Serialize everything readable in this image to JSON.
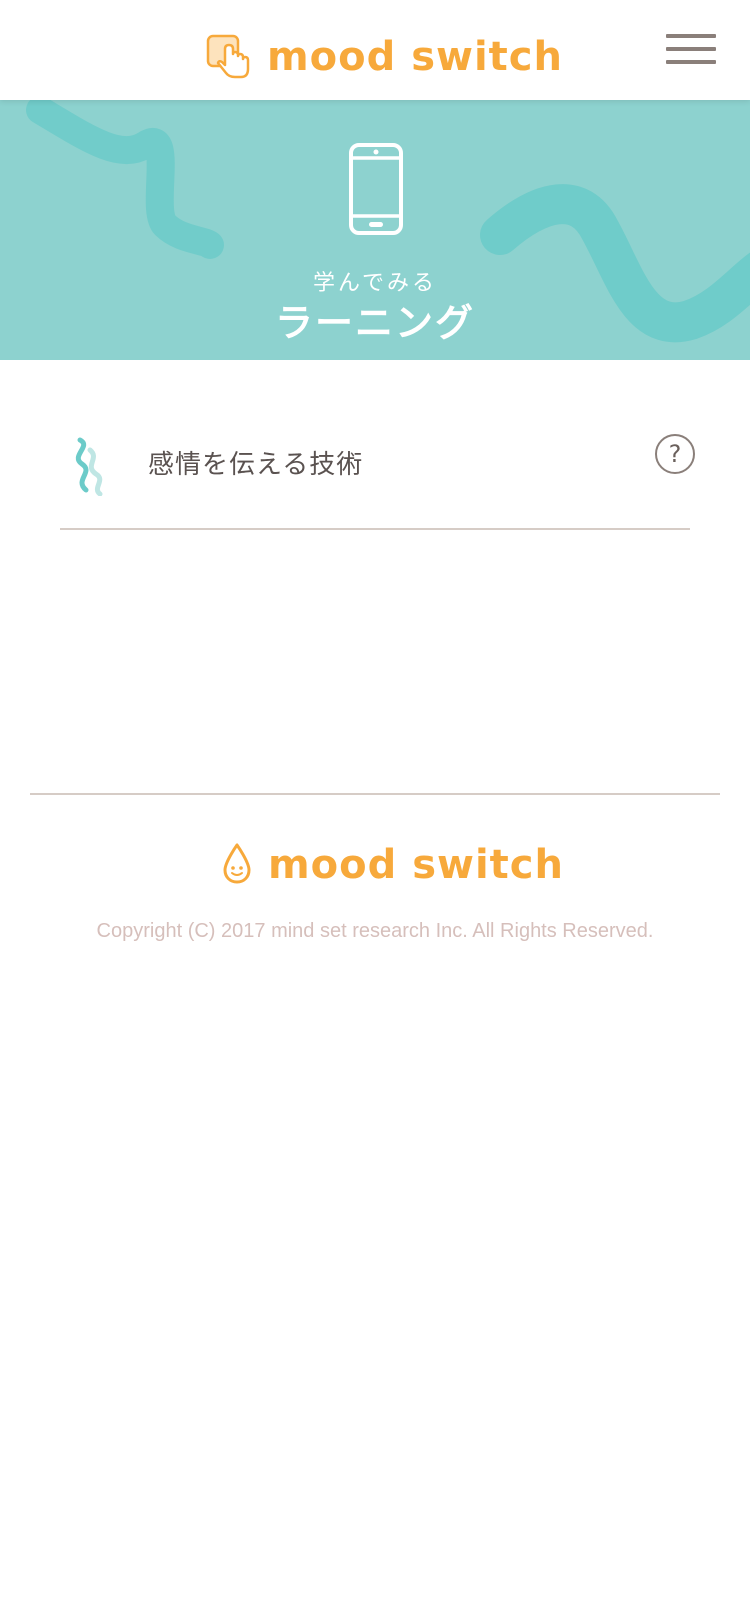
{
  "header": {
    "logo_text": "mood switch",
    "menu_icon": "hamburger-menu-icon"
  },
  "banner": {
    "icon": "smartphone-icon",
    "subtitle": "学んでみる",
    "title": "ラーニング"
  },
  "learning_items": [
    {
      "label": "感情を伝える技術",
      "icon": "wave-icon",
      "help_label": "?"
    }
  ],
  "footer": {
    "logo_text": "mood switch",
    "logo_icon": "droplet-smile-icon",
    "copyright": "Copyright (C) 2017 mind set research Inc. All Rights Reserved."
  },
  "colors": {
    "brand_orange": "#f7a93b",
    "banner_teal": "#8dd2cf",
    "wave_teal": "#6ccbc9",
    "divider": "#d6ccc6",
    "text_dark": "#5a5250",
    "copyright_text": "#d6bfbb"
  }
}
